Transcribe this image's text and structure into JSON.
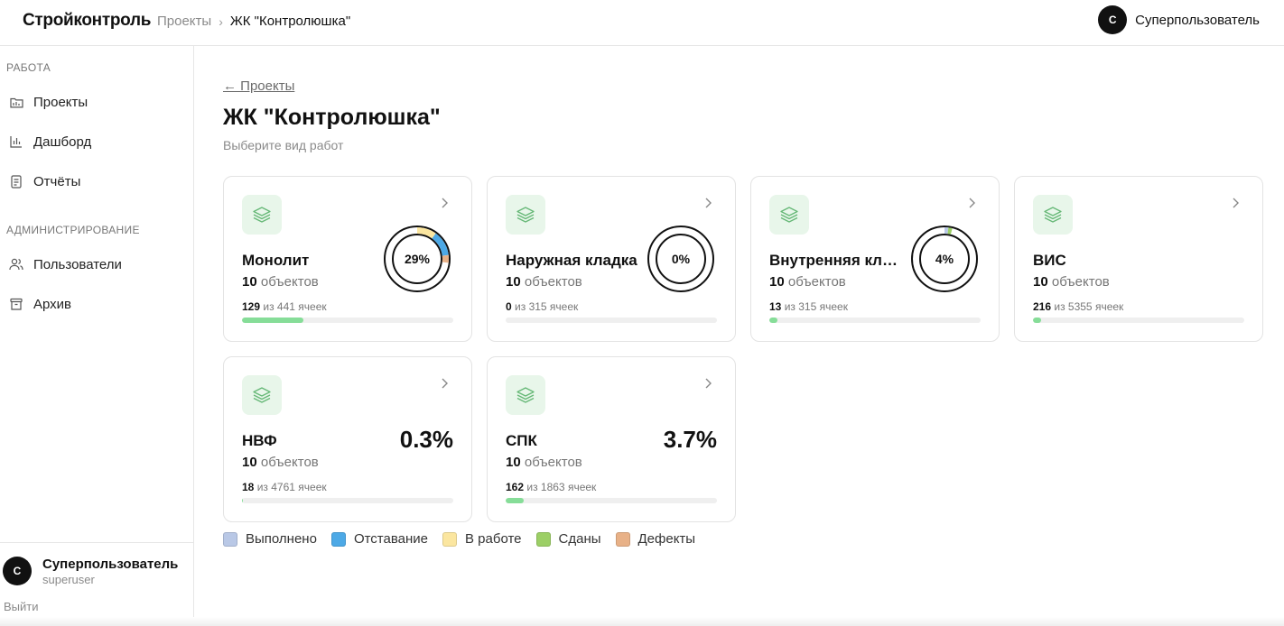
{
  "header": {
    "brand": "Стройконтроль",
    "breadcrumb": [
      "Проекты",
      "ЖК \"Контролюшка\""
    ],
    "user": {
      "initial": "С",
      "name": "Суперпользователь"
    }
  },
  "sidebar": {
    "section_work": "РАБОТА",
    "items_work": [
      {
        "label": "Проекты",
        "icon": "folder-icon"
      },
      {
        "label": "Дашборд",
        "icon": "bar-chart-icon"
      },
      {
        "label": "Отчёты",
        "icon": "report-icon"
      }
    ],
    "section_admin": "АДМИНИСТРИРОВАНИЕ",
    "items_admin": [
      {
        "label": "Пользователи",
        "icon": "users-icon"
      },
      {
        "label": "Архив",
        "icon": "archive-icon"
      }
    ],
    "footer": {
      "initial": "С",
      "name": "Суперпользователь",
      "login": "superuser",
      "logout": "Выйти"
    }
  },
  "main": {
    "back": "← Проекты",
    "title": "ЖК \"Контролюшка\"",
    "subtitle": "Выберите вид работ",
    "cards": [
      {
        "name": "Монолит",
        "objects": "10",
        "objects_label": "объектов",
        "done": "129",
        "of_label": "из 441 ячеек",
        "progress": 0.29,
        "ring": true,
        "percent": "29%"
      },
      {
        "name": "Наружная кладка",
        "objects": "10",
        "objects_label": "объектов",
        "done": "0",
        "of_label": "из 315 ячеек",
        "progress": 0.0,
        "ring": true,
        "percent": "0%"
      },
      {
        "name": "Внутренняя кладка",
        "objects": "10",
        "objects_label": "объектов",
        "done": "13",
        "of_label": "из 315 ячеек",
        "progress": 0.04,
        "ring": true,
        "percent": "4%"
      },
      {
        "name": "ВИС",
        "objects": "10",
        "objects_label": "объектов",
        "done": "216",
        "of_label": "из 5355 ячеек",
        "progress": 0.04,
        "ring": false,
        "percent": ""
      },
      {
        "name": "НВФ",
        "objects": "10",
        "objects_label": "объектов",
        "done": "18",
        "of_label": "из 4761 ячеек",
        "progress": 0.004,
        "ring": false,
        "percent": "0.3%"
      },
      {
        "name": "СПК",
        "objects": "10",
        "objects_label": "объектов",
        "done": "162",
        "of_label": "из 1863 ячеек",
        "progress": 0.087,
        "ring": false,
        "percent": "3.7%"
      }
    ],
    "ring_segments": {
      "monolit": [
        {
          "status": "В работе",
          "fraction": 0.1
        },
        {
          "status": "Отставание",
          "fraction": 0.13
        },
        {
          "status": "Дефекты",
          "fraction": 0.04
        }
      ],
      "inner": [
        {
          "status": "Выполнено",
          "fraction": 0.02
        },
        {
          "status": "Сданы",
          "fraction": 0.02
        }
      ]
    },
    "legend": [
      {
        "label": "Выполнено",
        "color": "#b9c8e6"
      },
      {
        "label": "Отставание",
        "color": "#4da9e6"
      },
      {
        "label": "В работе",
        "color": "#fbe6a0"
      },
      {
        "label": "Сданы",
        "color": "#9ccf66"
      },
      {
        "label": "Дефекты",
        "color": "#e8b187"
      }
    ]
  }
}
